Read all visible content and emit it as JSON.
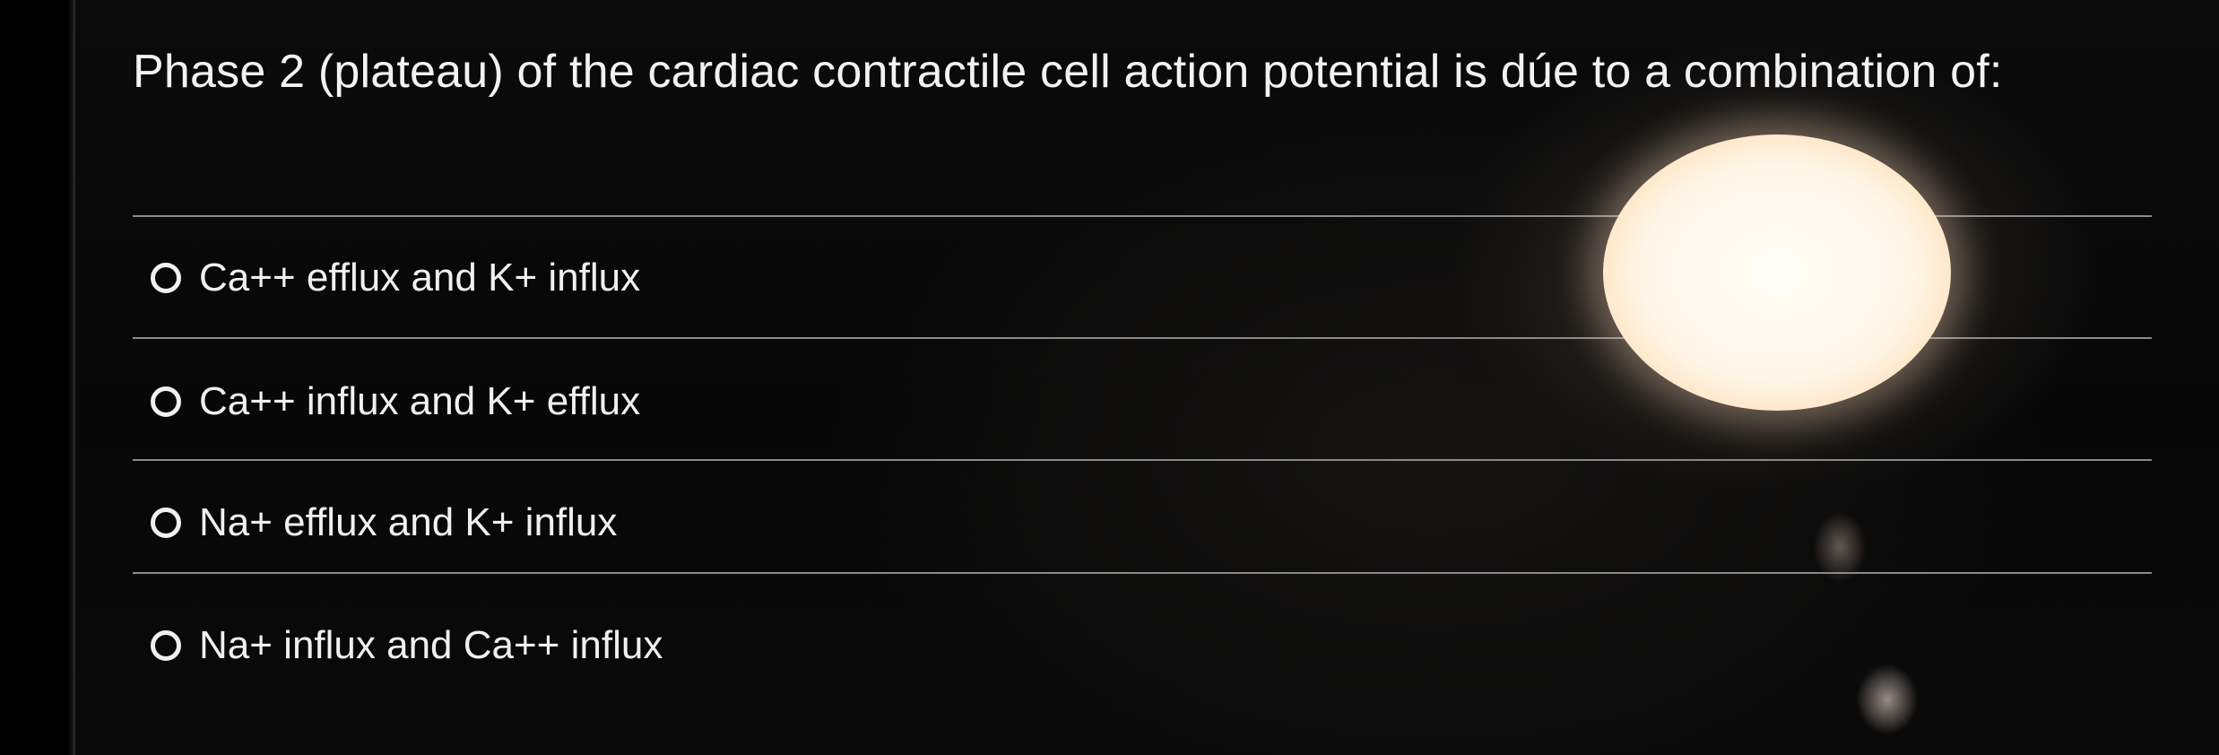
{
  "quiz": {
    "question": "Phase 2 (plateau) of the cardiac contractile cell action potential is dúe to a combination of:",
    "options": [
      {
        "label": "Ca++ efflux and K+ influx",
        "selected": false
      },
      {
        "label": "Ca++ influx and K+ efflux",
        "selected": false
      },
      {
        "label": "Na+ efflux and K+ influx",
        "selected": false
      },
      {
        "label": "Na+ influx and Ca++ influx",
        "selected": false
      }
    ]
  }
}
